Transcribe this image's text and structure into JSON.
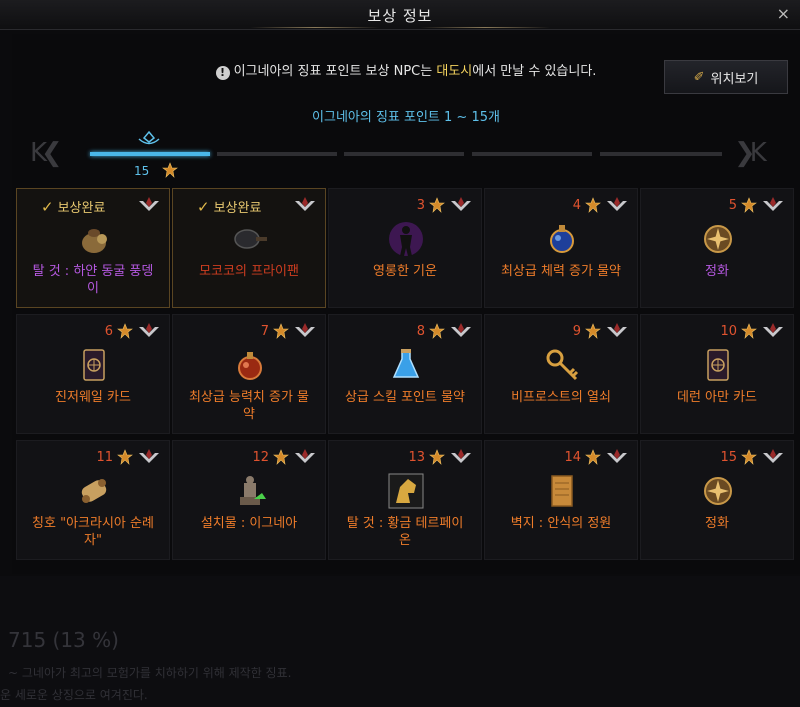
{
  "window": {
    "title": "보상 정보",
    "close": "×"
  },
  "notice": {
    "info": "!",
    "part1": "이그네아의 징표 포인트 보상 NPC는 ",
    "highlight": "대도시",
    "part2": "에서 만날 수 있습니다."
  },
  "location_button": {
    "label": "위치보기"
  },
  "range_label": "이그네아의 징표 포인트 1 ~ 15개",
  "progress": {
    "current": "15",
    "segments": 5,
    "active_segments": 1,
    "nav_left": "K❮",
    "nav_right": "❯K"
  },
  "colors": {
    "accent": "#4ab6e8",
    "gold": "#e0b84a",
    "purple": "#b558e0",
    "red": "#cf3d20",
    "orange": "#ee7c2a"
  },
  "rewards": [
    {
      "status": "보상완료",
      "name_lines": [
        "탈 것 : 하얀 동굴 풍뎅",
        "이"
      ],
      "color": "purple",
      "icon": "bag-icon"
    },
    {
      "status": "보상완료",
      "name_lines": [
        "모코코의 프라이팬"
      ],
      "color": "red",
      "icon": "frying-pan-icon"
    },
    {
      "num": "3",
      "name_lines": [
        "영롱한 기운"
      ],
      "color": "orange",
      "icon": "aura-figure-icon"
    },
    {
      "num": "4",
      "name_lines": [
        "최상급 체력 증가 물약"
      ],
      "color": "orange",
      "icon": "potion-icon"
    },
    {
      "num": "5",
      "name_lines": [
        "정화"
      ],
      "color": "purple",
      "icon": "compass-emblem-icon"
    },
    {
      "num": "6",
      "name_lines": [
        "진저웨일 카드"
      ],
      "color": "orange",
      "icon": "card-icon"
    },
    {
      "num": "7",
      "name_lines": [
        "최상급 능력치 증가 물",
        "약"
      ],
      "color": "orange",
      "icon": "red-potion-icon"
    },
    {
      "num": "8",
      "name_lines": [
        "상급 스킬 포인트 물약"
      ],
      "color": "orange",
      "icon": "blue-flask-icon"
    },
    {
      "num": "9",
      "name_lines": [
        "비프로스트의 열쇠"
      ],
      "color": "orange",
      "icon": "key-icon"
    },
    {
      "num": "10",
      "name_lines": [
        "데런 아만 카드"
      ],
      "color": "orange",
      "icon": "card-icon"
    },
    {
      "num": "11",
      "name_lines": [
        "칭호 \"아크라시아 순례",
        "자\""
      ],
      "color": "orange",
      "icon": "scroll-icon"
    },
    {
      "num": "12",
      "name_lines": [
        "설치물 : 이그네아"
      ],
      "color": "orange",
      "icon": "statue-icon"
    },
    {
      "num": "13",
      "name_lines": [
        "탈 것 : 황금 테르페이",
        "온"
      ],
      "color": "orange",
      "icon": "golden-horse-icon"
    },
    {
      "num": "14",
      "name_lines": [
        "벽지 : 안식의 정원"
      ],
      "color": "orange",
      "icon": "wallpaper-icon"
    },
    {
      "num": "15",
      "name_lines": [
        "정화"
      ],
      "color": "orange",
      "icon": "compass-emblem-icon"
    }
  ],
  "background": {
    "big": "715 (13 %)",
    "line1": "~ 그네아가 최고의 모험가를 치하하기 위해 제작한 징표.",
    "line2": "운 세로운 상징으로 여겨진다."
  }
}
